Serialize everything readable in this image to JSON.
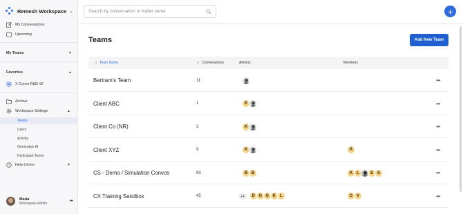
{
  "workspace": {
    "name": "Remesh Workspace"
  },
  "sidebar": {
    "my_conversations": "My Conversations",
    "upcoming": "Upcoming",
    "my_teams": "My Teams",
    "favorites": "Favorites",
    "favorite_item": "X Convo R&D #2",
    "archive": "Archive",
    "workspace_settings": "Workspace Settings",
    "settings_items": [
      "Teams",
      "Users",
      "Activity",
      "Generative AI",
      "Participant Terms"
    ],
    "help_center": "Help Center"
  },
  "user": {
    "name": "Maria",
    "role": "Workspace Admin"
  },
  "search": {
    "placeholder": "Search by conversation or folder name"
  },
  "page": {
    "title": "Teams",
    "add_button": "Add New Team"
  },
  "table": {
    "headers": {
      "name": "Team Name",
      "conversations": "Conversations",
      "admins": "Admins",
      "members": "Members"
    },
    "rows": [
      {
        "name": "Bertram's Team",
        "conversations": "11",
        "admins": [
          "photo"
        ],
        "extra": "",
        "members": []
      },
      {
        "name": "Client ABC",
        "conversations": "1",
        "admins": [
          "K",
          "photo"
        ],
        "extra": "",
        "members": []
      },
      {
        "name": "Client Co (NR)",
        "conversations": "3",
        "admins": [
          "K",
          "photo"
        ],
        "extra": "",
        "members": []
      },
      {
        "name": "Client XYZ",
        "conversations": "9",
        "admins": [
          "K",
          "photo"
        ],
        "extra": "",
        "members": [
          "R"
        ]
      },
      {
        "name": "CS - Demo / Simulation Convos",
        "conversations": "90",
        "admins": [
          "B",
          "B"
        ],
        "extra": "",
        "members": [
          "K",
          "L",
          "photo",
          "S",
          "S"
        ]
      },
      {
        "name": "CX Training Sandbox",
        "conversations": "45",
        "admins": [
          "D",
          "G",
          "G",
          "K",
          "L"
        ],
        "extra": "+4",
        "members": [
          "G",
          "V"
        ]
      }
    ]
  },
  "colors": {
    "accent": "#2d6cdf",
    "avatar": "#f6d48a"
  }
}
